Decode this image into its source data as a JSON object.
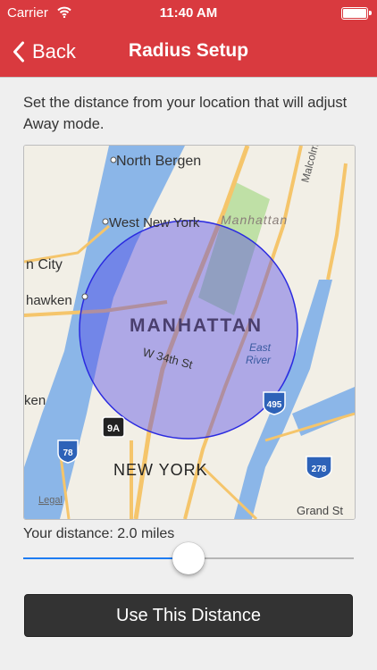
{
  "status_bar": {
    "carrier": "Carrier",
    "time": "11:40 AM",
    "wifi_icon": "wifi-icon",
    "battery_icon": "battery-icon"
  },
  "nav": {
    "back_label": "Back",
    "title": "Radius Setup",
    "back_icon": "chevron-left-icon"
  },
  "instructions": "Set the distance from your location that will adjust Away mode.",
  "map": {
    "place_labels": {
      "north_bergen": "North Bergen",
      "west_new_york": "West New York",
      "manhattan_small": "Manhattan",
      "malcolm": "Malcolm",
      "union_city": "n City",
      "weehawken": "hawken",
      "manhattan": "MANHATTAN",
      "w34": "W 34th St",
      "east_river_1": "East",
      "east_river_2": "River",
      "new_york": "NEW YORK",
      "jersey": "ken",
      "grand": "Grand St",
      "legal": "Legal"
    },
    "shields": {
      "i495": "495",
      "i78": "78",
      "r9a": "9A",
      "i278": "278"
    },
    "radius_circle_color": "#2a2ae0"
  },
  "distance": {
    "label": "Your distance: 2.0 miles",
    "value_miles": 2.0,
    "slider_fraction": 0.5
  },
  "colors": {
    "nav_background": "#d93a3f",
    "slider_fill": "#1e7cf2",
    "button_background": "#333333"
  },
  "button": {
    "label": "Use This Distance"
  }
}
